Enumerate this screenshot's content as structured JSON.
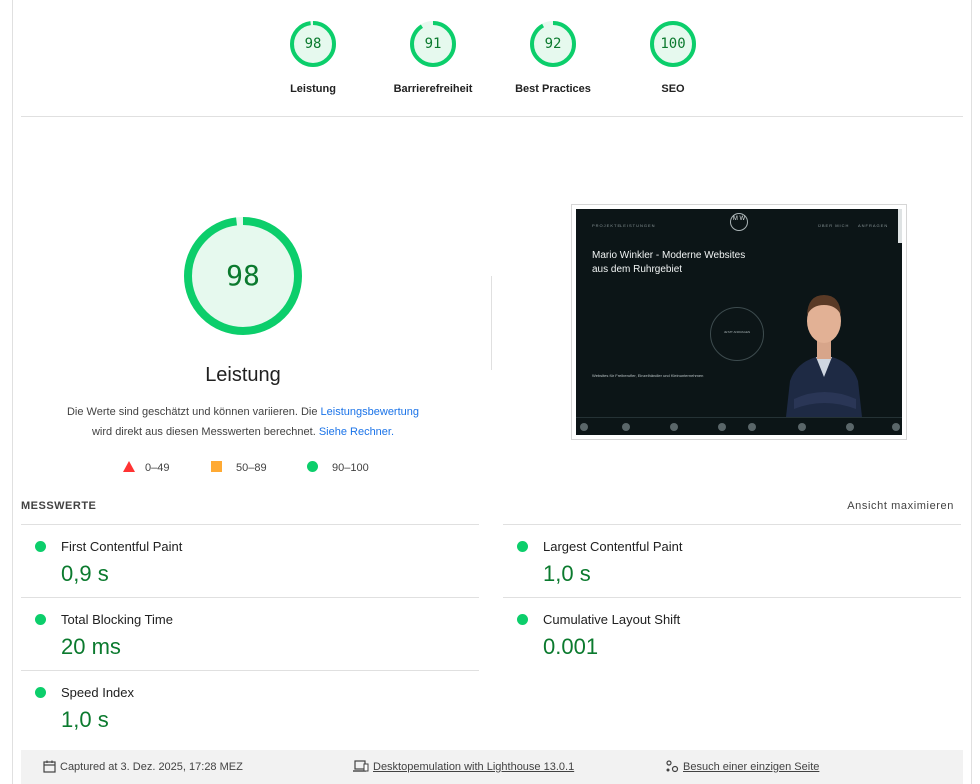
{
  "colors": {
    "pass_green": "#0cce6b",
    "pass_text": "#0b7a2e",
    "fail_red": "#ff3333",
    "average_orange": "#ffaa33",
    "link_blue": "#1a73e8"
  },
  "category_gauges": [
    {
      "label": "Leistung",
      "score": "98",
      "fraction": 0.98
    },
    {
      "label": "Barrierefreiheit",
      "score": "91",
      "fraction": 0.91
    },
    {
      "label": "Best Practices",
      "score": "92",
      "fraction": 0.92
    },
    {
      "label": "SEO",
      "score": "100",
      "fraction": 1.0
    }
  ],
  "performance": {
    "score": "98",
    "fraction": 0.98,
    "title": "Leistung",
    "desc_part1": "Die Werte sind geschätzt und können variieren. Die",
    "desc_link1": "Leistungsbewertung",
    "desc_part2": "wird direkt aus diesen Messwerten berechnet.",
    "desc_link2": "Siehe Rechner."
  },
  "legend": {
    "fail": "0–49",
    "average": "50–89",
    "pass": "90–100"
  },
  "screenshot": {
    "nav_left_1": "PROJEKTE",
    "nav_left_2": "LEISTUNGEN",
    "nav_right_1": "ÜBER MICH",
    "nav_right_2": "ANFRAGEN",
    "logo": "M W",
    "headline": "Mario Winkler - Moderne Websites aus dem Ruhrgebiet",
    "subtext": "Websites für Freiberufler, Einzelhändler und Kleinunternehmen",
    "circle_text": "JETZT ANFRAGEN"
  },
  "metrics": {
    "header": "MESSWERTE",
    "maximize": "Ansicht maximieren",
    "items": [
      {
        "name": "First Contentful Paint",
        "value": "0,9 s"
      },
      {
        "name": "Largest Contentful Paint",
        "value": "1,0 s"
      },
      {
        "name": "Total Blocking Time",
        "value": "20 ms"
      },
      {
        "name": "Cumulative Layout Shift",
        "value": "0.001"
      },
      {
        "name": "Speed Index",
        "value": "1,0 s"
      }
    ]
  },
  "footer": {
    "captured": "Captured at 3. Dez. 2025, 17:28 MEZ",
    "emulation": "Desktopemulation with Lighthouse 13.0.1",
    "session": "Besuch einer einzigen Seite"
  }
}
